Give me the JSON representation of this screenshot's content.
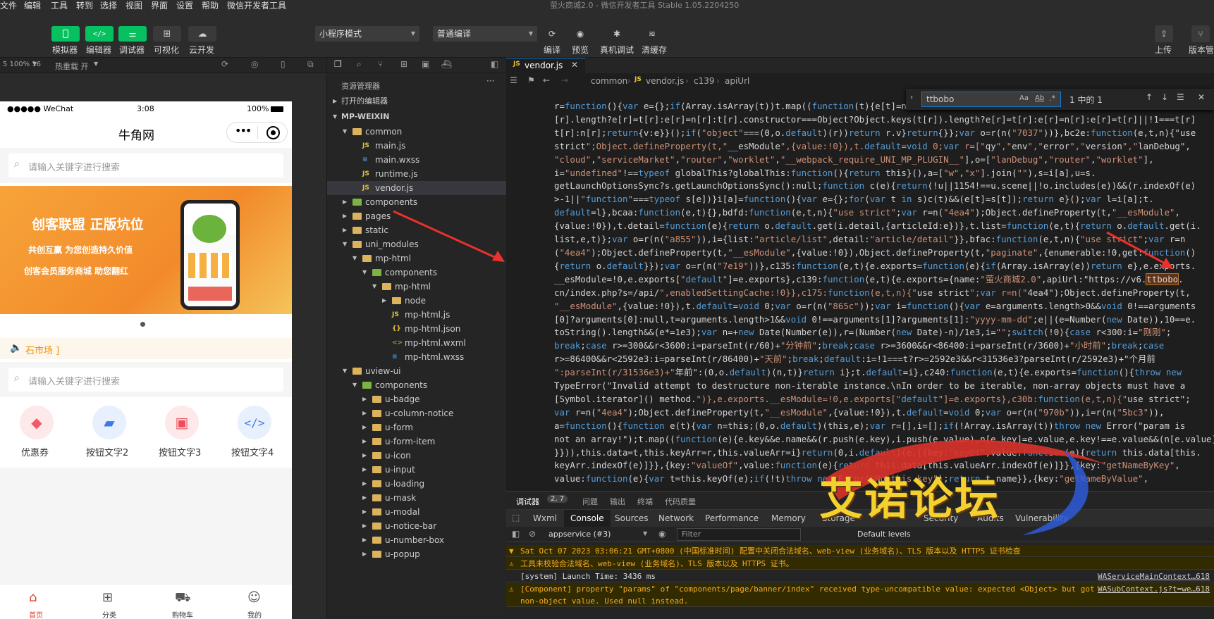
{
  "menubar": {
    "items": [
      "文件",
      "编辑",
      "工具",
      "转到",
      "选择",
      "视图",
      "界面",
      "设置",
      "帮助",
      "微信开发者工具"
    ],
    "title": "萤火商城2.0 - 微信开发者工具 Stable 1.05.2204250"
  },
  "toolbar": {
    "simulator": "模拟器",
    "editor": "编辑器",
    "debugger": "调试器",
    "visual": "可视化",
    "cloud": "云开发",
    "mode": "小程序模式",
    "compile": "普通编译",
    "compile_btn": "编译",
    "preview": "预览",
    "device_debug": "真机调试",
    "clear_cache": "清缓存",
    "upload": "上传",
    "version": "版本管"
  },
  "simbar": {
    "device": "5 100% 16",
    "hot_reload": "热重载 开"
  },
  "phone": {
    "status_left": "●●●●● WeChat",
    "time": "3:08",
    "battery": "100%",
    "title": "牛角网",
    "search1": "请输入关键字进行搜索",
    "banner_text1": "创客联盟 正版坑位",
    "banner_text2": "共创互赢 为您创造持久价值",
    "banner_text3": "创客会员服务商城 助您翻红",
    "notice": "石市场 ]",
    "search2": "请输入关键字进行搜索",
    "grid": [
      "优惠券",
      "按钮文字2",
      "按钮文字3",
      "按钮文字4"
    ],
    "tabs": [
      "首页",
      "分类",
      "购物车",
      "我的"
    ],
    "brand_color": "#e33d2c"
  },
  "explorer": {
    "title": "资源管理器",
    "open_editors": "打开的编辑器",
    "project": "MP-WEIXIN",
    "tree": [
      {
        "label": "common",
        "depth": 1,
        "type": "folder-open",
        "icon": "folder"
      },
      {
        "label": "main.js",
        "depth": 2,
        "type": "js"
      },
      {
        "label": "main.wxss",
        "depth": 2,
        "type": "wxss"
      },
      {
        "label": "runtime.js",
        "depth": 2,
        "type": "js"
      },
      {
        "label": "vendor.js",
        "depth": 2,
        "type": "js",
        "selected": true
      },
      {
        "label": "components",
        "depth": 1,
        "type": "folder-closed",
        "icon": "folder-green"
      },
      {
        "label": "pages",
        "depth": 1,
        "type": "folder-closed",
        "icon": "folder"
      },
      {
        "label": "static",
        "depth": 1,
        "type": "folder-closed",
        "icon": "folder"
      },
      {
        "label": "uni_modules",
        "depth": 1,
        "type": "folder-open",
        "icon": "folder"
      },
      {
        "label": "mp-html",
        "depth": 2,
        "type": "folder-open",
        "icon": "folder"
      },
      {
        "label": "components",
        "depth": 3,
        "type": "folder-open",
        "icon": "folder-green"
      },
      {
        "label": "mp-html",
        "depth": 4,
        "type": "folder-open",
        "icon": "folder"
      },
      {
        "label": "node",
        "depth": 5,
        "type": "folder-closed",
        "icon": "folder"
      },
      {
        "label": "mp-html.js",
        "depth": 5,
        "type": "js"
      },
      {
        "label": "mp-html.json",
        "depth": 5,
        "type": "json"
      },
      {
        "label": "mp-html.wxml",
        "depth": 5,
        "type": "wxml"
      },
      {
        "label": "mp-html.wxss",
        "depth": 5,
        "type": "wxss"
      },
      {
        "label": "uview-ui",
        "depth": 1,
        "type": "folder-open",
        "icon": "folder"
      },
      {
        "label": "components",
        "depth": 2,
        "type": "folder-open",
        "icon": "folder-green"
      },
      {
        "label": "u-badge",
        "depth": 3,
        "type": "folder-closed",
        "icon": "folder"
      },
      {
        "label": "u-column-notice",
        "depth": 3,
        "type": "folder-closed",
        "icon": "folder"
      },
      {
        "label": "u-form",
        "depth": 3,
        "type": "folder-closed",
        "icon": "folder"
      },
      {
        "label": "u-form-item",
        "depth": 3,
        "type": "folder-closed",
        "icon": "folder"
      },
      {
        "label": "u-icon",
        "depth": 3,
        "type": "folder-closed",
        "icon": "folder"
      },
      {
        "label": "u-input",
        "depth": 3,
        "type": "folder-closed",
        "icon": "folder"
      },
      {
        "label": "u-loading",
        "depth": 3,
        "type": "folder-closed",
        "icon": "folder"
      },
      {
        "label": "u-mask",
        "depth": 3,
        "type": "folder-closed",
        "icon": "folder"
      },
      {
        "label": "u-modal",
        "depth": 3,
        "type": "folder-closed",
        "icon": "folder"
      },
      {
        "label": "u-notice-bar",
        "depth": 3,
        "type": "folder-closed",
        "icon": "folder"
      },
      {
        "label": "u-number-box",
        "depth": 3,
        "type": "folder-closed",
        "icon": "folder"
      },
      {
        "label": "u-popup",
        "depth": 3,
        "type": "folder-closed",
        "icon": "folder"
      }
    ]
  },
  "editor": {
    "tab": "vendor.js",
    "breadcrumb": [
      "common",
      "vendor.js",
      "c139",
      "apiUrl"
    ],
    "find_value": "ttbobo",
    "find_result": "1 中的 1",
    "code": [
      "r=function(){var e={};if(Array.isArray(t))t.map((function(t){e[t]=n",
      "[r].length?e[r]=t[r]:e[r]=n[r]:t[r].constructor===Object?Object.keys(t[r]).length?e[r]=t[r]:e[r]=n[r]:e[r]=t[r]||!1===t[r]",
      "t[r]:n[r];return{v:e}}();if(\"object\"===(0,o.default)(r))return r.v}return{}};var o=r(n(\"7037\"))},bc2e:function(e,t,n){\"use",
      "strict\";Object.defineProperty(t,\"__esModule\",{value:!0}),t.default=void 0;var r=[\"qy\",\"env\",\"error\",\"version\",\"lanDebug\",",
      "\"cloud\",\"serviceMarket\",\"router\",\"worklet\",\"__webpack_require_UNI_MP_PLUGIN__\"],o=[\"lanDebug\",\"router\",\"worklet\"],",
      "i=\"undefined\"!==typeof globalThis?globalThis:function(){return this}(),a=[\"w\",\"x\"].join(\"\"),s=i[a],u=s.",
      "getLaunchOptionsSync?s.getLaunchOptionsSync():null;function c(e){return(!u||1154!==u.scene||!o.includes(e))&&(r.indexOf(e)",
      ">-1||\"function\"===typeof s[e])}i[a]=function(){var e={};for(var t in s)c(t)&&(e[t]=s[t]);return e}();var l=i[a];t.",
      "default=l},bcaa:function(e,t){},bdfd:function(e,t,n){\"use strict\";var r=n(\"4ea4\");Object.defineProperty(t,\"__esModule\",",
      "{value:!0}),t.detail=function(e){return o.default.get(i.detail,{articleId:e})},t.list=function(e,t){return o.default.get(i.",
      "list,e,t)};var o=r(n(\"a855\")),i={list:\"article/list\",detail:\"article/detail\"}},bfac:function(e,t,n){\"use strict\";var r=n",
      "(\"4ea4\");Object.defineProperty(t,\"__esModule\",{value:!0}),Object.defineProperty(t,\"paginate\",{enumerable:!0,get:function()",
      "{return o.default}});var o=r(n(\"7e19\"))},c135:function(e,t){e.exports=function(e){if(Array.isArray(e))return e},e.exports.",
      "__esModule=!0,e.exports[\"default\"]=e.exports},c139:function(e,t){e.exports={name:\"萤火商城2.0\",apiUrl:\"https://v6.ttbobo.",
      "cn/index.php?s=/api/\",enabledSettingCache:!0}},c175:function(e,t,n){\"use strict\";var r=n(\"4ea4\");Object.defineProperty(t,",
      "\"__esModule\",{value:!0}),t.default=void 0;var o=r(n(\"865c\"));var i=function(){var e=arguments.length>0&&void 0!==arguments",
      "[0]?arguments[0]:null,t=arguments.length>1&&void 0!==arguments[1]?arguments[1]:\"yyyy-mm-dd\";e||(e=Number(new Date)),10==e.",
      "toString().length&&(e*=1e3);var n=+new Date(Number(e)),r=(Number(new Date)-n)/1e3,i=\"\";switch(!0){case r<300:i=\"刚刚\";",
      "break;case r>=300&&r<3600:i=parseInt(r/60)+\"分钟前\";break;case r>=3600&&r<86400:i=parseInt(r/3600)+\"小时前\";break;case",
      "r>=86400&&r<2592e3:i=parseInt(r/86400)+\"天前\";break;default:i=!1===t?r>=2592e3&&r<31536e3?parseInt(r/2592e3)+\"个月前",
      "\":parseInt(r/31536e3)+\"年前\":(0,o.default)(n,t)}return i};t.default=i},c240:function(e,t){e.exports=function(){throw new",
      "TypeError(\"Invalid attempt to destructure non-iterable instance.\\nIn order to be iterable, non-array objects must have a",
      "[Symbol.iterator]() method.\")},e.exports.__esModule=!0,e.exports[\"default\"]=e.exports},c30b:function(e,t,n){\"use strict\";",
      "var r=n(\"4ea4\");Object.defineProperty(t,\"__esModule\",{value:!0}),t.default=void 0;var o=r(n(\"970b\")),i=r(n(\"5bc3\")),",
      "a=function(){function e(t){var n=this;(0,o.default)(this,e);var r=[],i=[];if(!Array.isArray(t))throw new Error(\"param is",
      "not an array!\");t.map((function(e){e.key&&e.name&&(r.push(e.key),i.push(e.value),n[e.key]=e.value,e.key!==e.value&&(n[e.value]=e",
      "}})),this.data=t,this.keyArr=r,this.valueArr=i}return(0,i.default)(e,[{key:\"keyOf\",value:function(e){return this.data[this.",
      "keyArr.indexOf(e)]}},{key:\"valueOf\",value:function(e){return this.data[this.valueArr.indexOf(e)]}},{key:\"getNameByKey\",",
      "value:function(e){var t=this.keyOf(e);if(!t)throw new Error(\"No this key\");return t.name}},{key:\"getNameByValue\","
    ]
  },
  "console": {
    "tabs": [
      "调试器",
      "问题",
      "输出",
      "终端",
      "代码质量"
    ],
    "badge": "2, 7",
    "devtabs": [
      "Wxml",
      "Console",
      "Sources",
      "Network",
      "Performance",
      "Memory",
      "Storage",
      "Security",
      "Audits",
      "Vulnerability"
    ],
    "context": "appservice (#3)",
    "filter": "Filter",
    "levels": "Default levels",
    "lines": [
      {
        "text": "Sat Oct 07 2023 03:06:21 GMT+0800 (中国标准时间) 配置中关闭合法域名、web-view (业务域名)、TLS 版本以及 HTTPS 证书检查",
        "type": "warn",
        "src": ""
      },
      {
        "text": "工具未校验合法域名、web-view (业务域名)、TLS 版本以及 HTTPS 证书。",
        "type": "warn",
        "src": ""
      },
      {
        "text": "[system] Launch Time: 3436 ms",
        "type": "log",
        "src": "WAServiceMainContext…618"
      },
      {
        "text": "[Component] property \"params\" of \"components/page/banner/index\" received type-uncompatible value: expected <Object> but got non-object value. Used null instead.",
        "type": "warn",
        "src": "WASubContext.js?t=we…618"
      }
    ]
  },
  "watermark": "艾诺论坛"
}
